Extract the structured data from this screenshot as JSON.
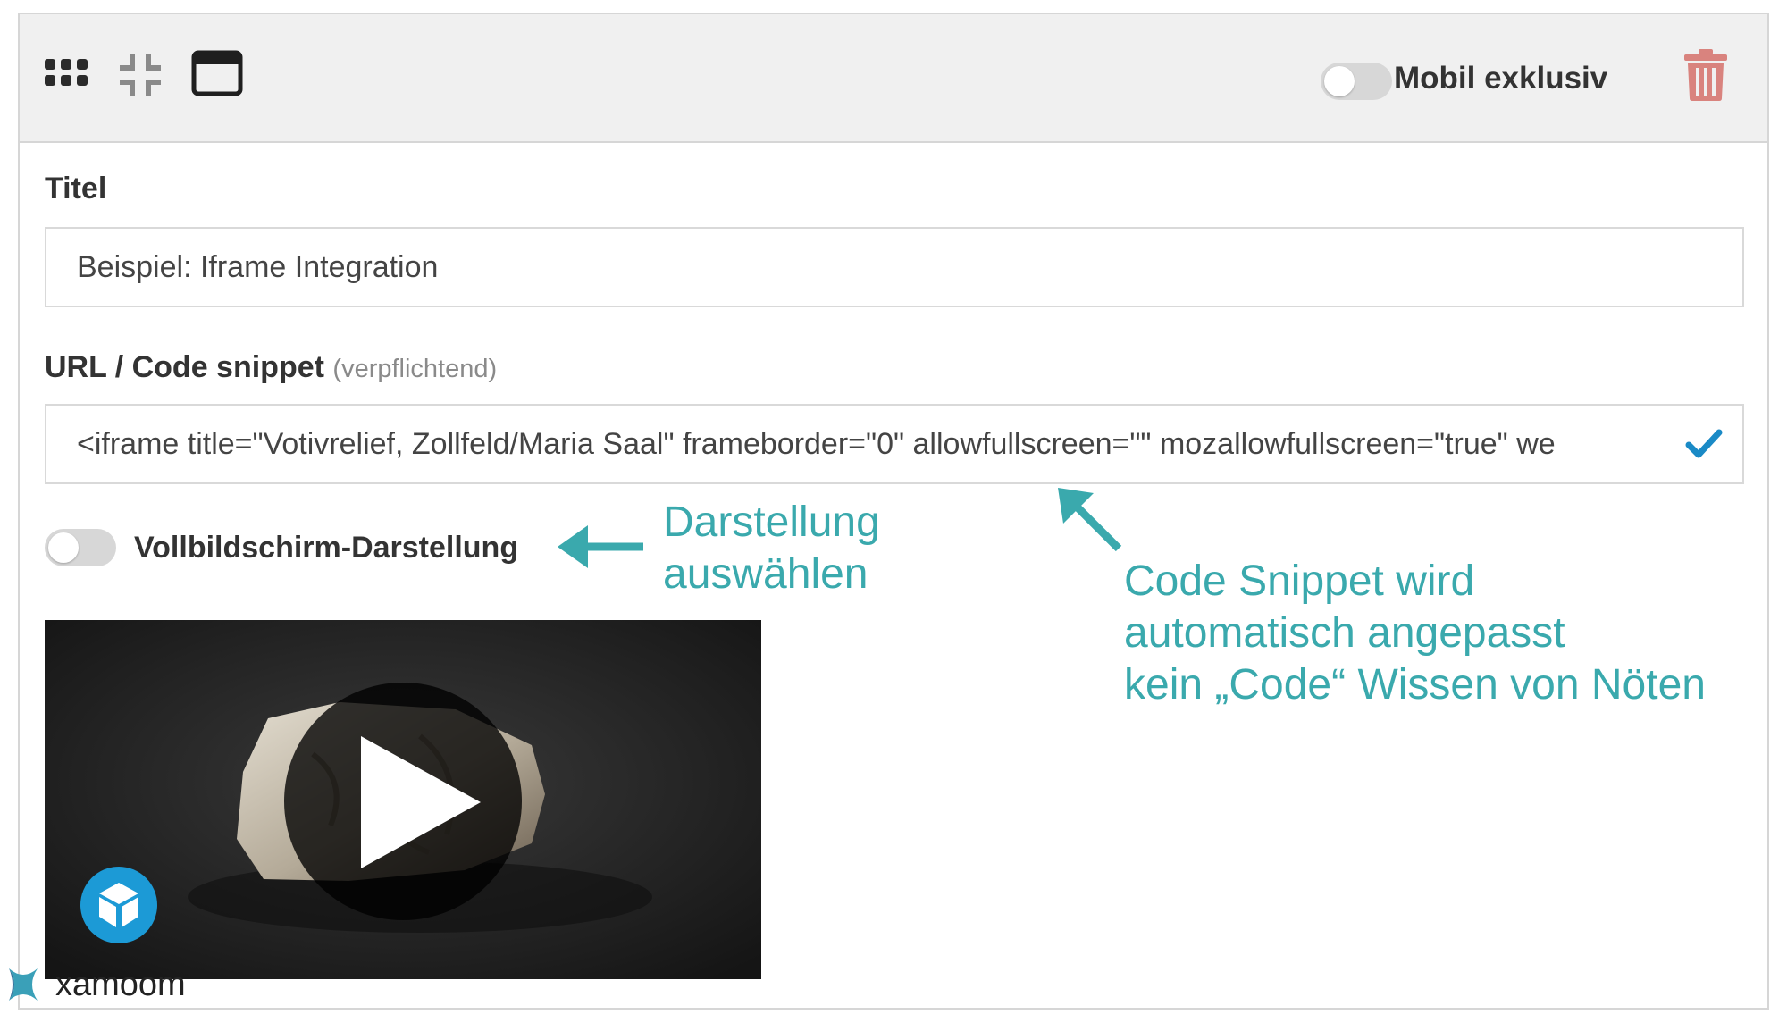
{
  "toolbar": {
    "icons": [
      "grid-icon",
      "compress-icon",
      "window-icon"
    ],
    "mobile_toggle": {
      "label": "Mobil exklusiv",
      "on": false
    },
    "delete_icon": "trash-icon"
  },
  "title_field": {
    "label": "Titel",
    "value": "Beispiel: Iframe Integration"
  },
  "url_field": {
    "label": "URL / Code snippet",
    "hint": "(verpflichtend)",
    "value": "<iframe title=\"Votivrelief, Zollfeld/Maria Saal\" frameborder=\"0\" allowfullscreen=\"\" mozallowfullscreen=\"true\" we",
    "valid_icon": "checkmark-icon"
  },
  "fullscreen_toggle": {
    "label": "Vollbildschirm-Darstellung",
    "on": false
  },
  "annotations": {
    "left": [
      "Darstellung",
      "auswählen"
    ],
    "right": [
      "Code Snippet wird",
      "automatisch angepasst",
      "kein „Code“ Wissen von Nöten"
    ]
  },
  "preview": {
    "play_icon": "play-icon",
    "badge_icon": "cube-icon"
  },
  "footer": {
    "brand": "xamoom"
  },
  "colors": {
    "accent": "#3aa9ad",
    "check": "#1a8ac6",
    "trash": "#d9837e",
    "toolbar_bg": "#f0f0f0"
  }
}
